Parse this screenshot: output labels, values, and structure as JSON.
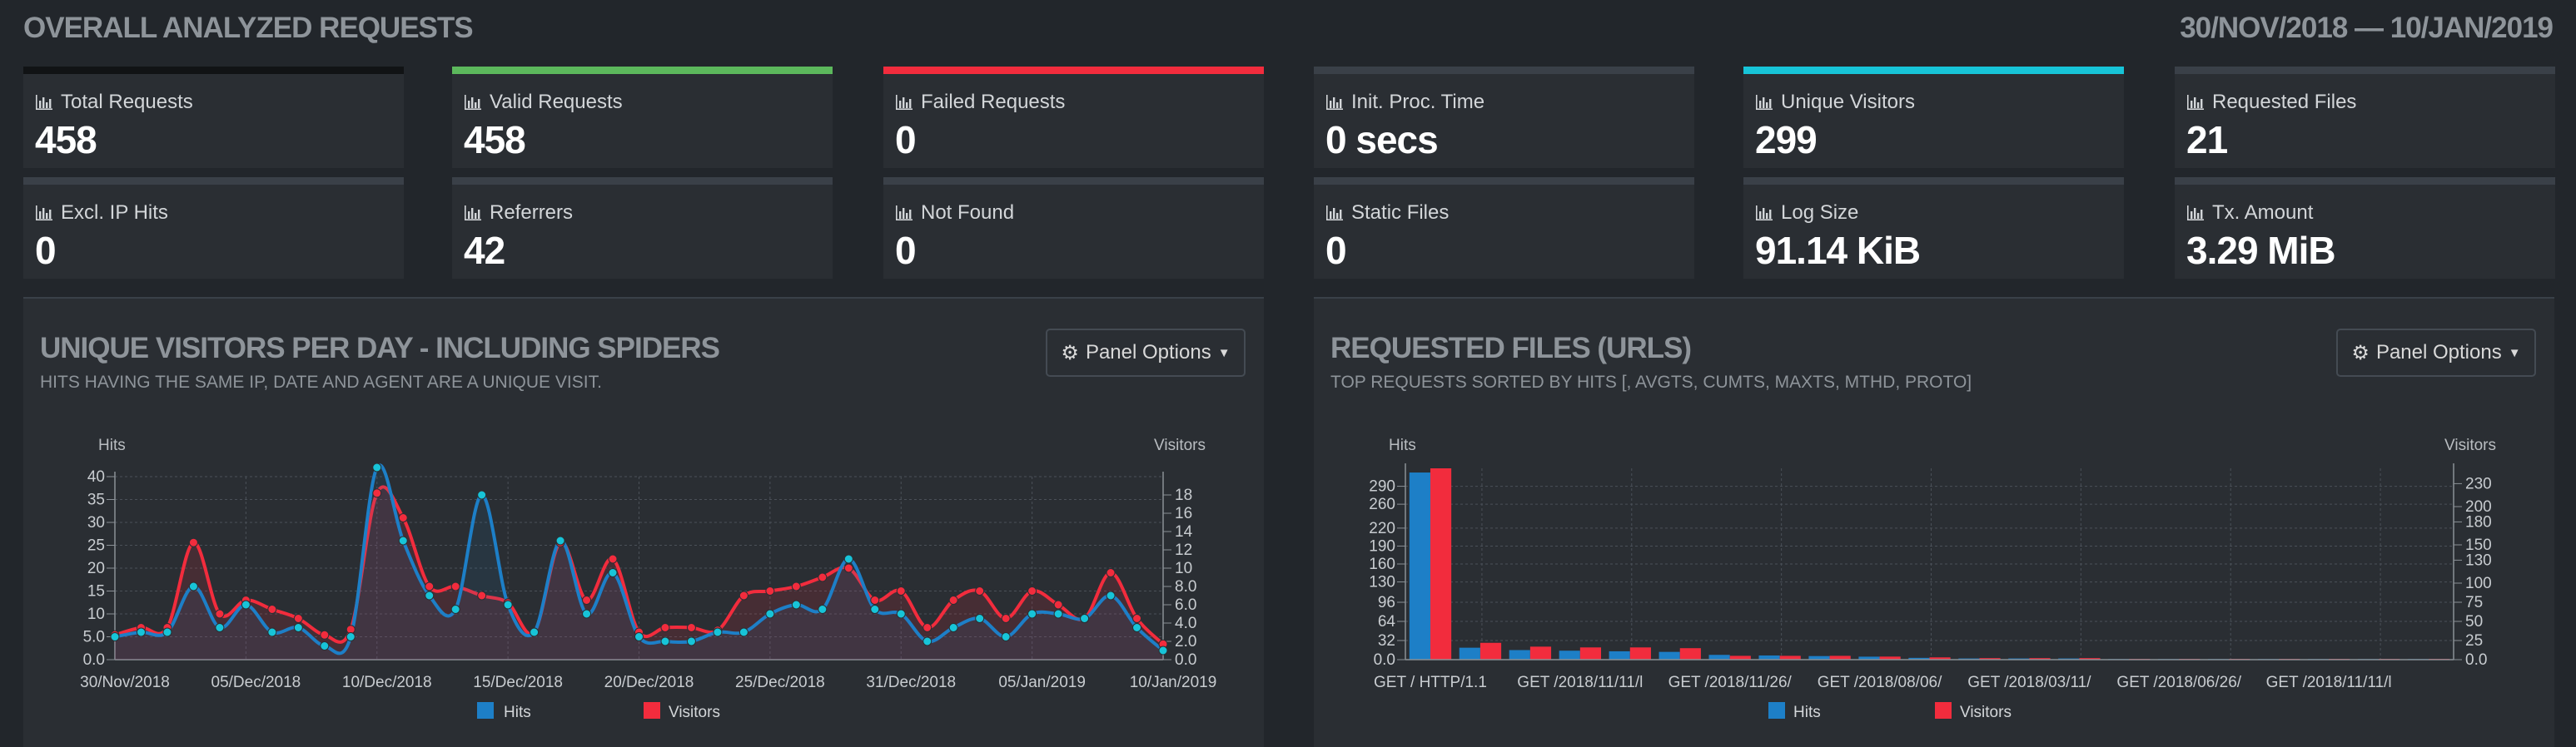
{
  "header": {
    "title": "OVERALL ANALYZED REQUESTS",
    "date_range": "30/NOV/2018 — 10/JAN/2019"
  },
  "colors": {
    "hits": "#1d7fc7",
    "visitors": "#f22c3d",
    "green": "#5cb85c",
    "red": "#f22c3d",
    "cyan": "#17c4d8",
    "neutral": "#3a4048"
  },
  "stats": [
    {
      "label": "Total Requests",
      "value": "458",
      "accent": "#111315"
    },
    {
      "label": "Valid Requests",
      "value": "458",
      "accent": "#5cb85c"
    },
    {
      "label": "Failed Requests",
      "value": "0",
      "accent": "#f22c3d"
    },
    {
      "label": "Init. Proc. Time",
      "value": "0 secs",
      "accent": "#3a4048"
    },
    {
      "label": "Unique Visitors",
      "value": "299",
      "accent": "#17c4d8"
    },
    {
      "label": "Requested Files",
      "value": "21",
      "accent": "#3a4048"
    },
    {
      "label": "Excl. IP Hits",
      "value": "0",
      "accent": "#3a4048"
    },
    {
      "label": "Referrers",
      "value": "42",
      "accent": "#3a4048"
    },
    {
      "label": "Not Found",
      "value": "0",
      "accent": "#3a4048"
    },
    {
      "label": "Static Files",
      "value": "0",
      "accent": "#3a4048"
    },
    {
      "label": "Log Size",
      "value": "91.14 KiB",
      "accent": "#3a4048"
    },
    {
      "label": "Tx. Amount",
      "value": "3.29 MiB",
      "accent": "#3a4048"
    }
  ],
  "panels": {
    "visitors": {
      "title": "UNIQUE VISITORS PER DAY - INCLUDING SPIDERS",
      "subtitle": "HITS HAVING THE SAME IP, DATE AND AGENT ARE A UNIQUE VISIT.",
      "options_label": "Panel Options"
    },
    "requests": {
      "title": "REQUESTED FILES (URLS)",
      "subtitle": "TOP REQUESTS SORTED BY HITS [, AVGTS, CUMTS, MAXTS, MTHD, PROTO]",
      "options_label": "Panel Options"
    }
  },
  "chart_data": [
    {
      "type": "line",
      "ylabel": "Hits",
      "y2label": "Visitors",
      "ylim": [
        0,
        40
      ],
      "y2lim": [
        0,
        20
      ],
      "y_ticks": [
        "0.0",
        "5.0",
        "10",
        "15",
        "20",
        "25",
        "30",
        "35",
        "40"
      ],
      "y2_ticks": [
        "0.0",
        "2.0",
        "4.0",
        "6.0",
        "8.0",
        "10",
        "12",
        "14",
        "16",
        "18"
      ],
      "x_tick_labels": [
        "30/Nov/2018",
        "05/Dec/2018",
        "10/Dec/2018",
        "15/Dec/2018",
        "20/Dec/2018",
        "25/Dec/2018",
        "31/Dec/2018",
        "05/Jan/2019",
        "10/Jan/2019"
      ],
      "grid": true,
      "legend": "bottom",
      "series": [
        {
          "name": "Hits",
          "axis": "left",
          "values": [
            5,
            6,
            6,
            16,
            7,
            12,
            6,
            7,
            3,
            5,
            42,
            26,
            14,
            11,
            36,
            12,
            6,
            26,
            10,
            19,
            5,
            4,
            4,
            6,
            6,
            10,
            12,
            11,
            22,
            11,
            10,
            4,
            7,
            9,
            5,
            10,
            10,
            9,
            14,
            7,
            2
          ]
        },
        {
          "name": "Visitors",
          "axis": "right",
          "values": [
            2.7,
            3.5,
            3.5,
            12.8,
            5,
            6.5,
            5.5,
            4.5,
            2.7,
            3.3,
            18.2,
            15.5,
            8,
            8,
            7,
            6.2,
            3,
            12.8,
            6.5,
            11,
            3,
            3.5,
            3.5,
            3.2,
            7,
            7.5,
            8,
            9,
            10,
            6.5,
            7.5,
            3.5,
            6.5,
            7.5,
            4.5,
            7.5,
            6,
            4.5,
            9.5,
            4.5,
            1.7
          ]
        }
      ]
    },
    {
      "type": "bar",
      "ylabel": "Hits",
      "y2label": "Visitors",
      "ylim": [
        0,
        320
      ],
      "y2lim": [
        0,
        250
      ],
      "y_ticks": [
        "0.0",
        "32",
        "64",
        "96",
        "130",
        "160",
        "190",
        "220",
        "260",
        "290"
      ],
      "y2_ticks": [
        "0.0",
        "25",
        "50",
        "75",
        "100",
        "130",
        "150",
        "180",
        "200",
        "230"
      ],
      "category_labels": [
        "GET / HTTP/1.1",
        "GET /2018/11/11/l",
        "GET /2018/11/26/",
        "GET /2018/08/06/",
        "GET /2018/03/11/",
        "GET /2018/06/26/",
        "GET /2018/11/11/l"
      ],
      "grid": true,
      "legend": "bottom",
      "series": [
        {
          "name": "Hits",
          "axis": "left",
          "values": [
            313,
            20,
            16,
            15,
            14,
            13,
            8,
            7,
            6,
            5,
            3,
            2,
            2,
            2,
            1,
            1,
            1,
            1,
            1,
            1,
            1
          ]
        },
        {
          "name": "Visitors",
          "axis": "right",
          "values": [
            250,
            22,
            17,
            16,
            16,
            15,
            5,
            5,
            5,
            4,
            3,
            2,
            2,
            2,
            1,
            1,
            1,
            1,
            1,
            1,
            1
          ]
        }
      ]
    }
  ]
}
